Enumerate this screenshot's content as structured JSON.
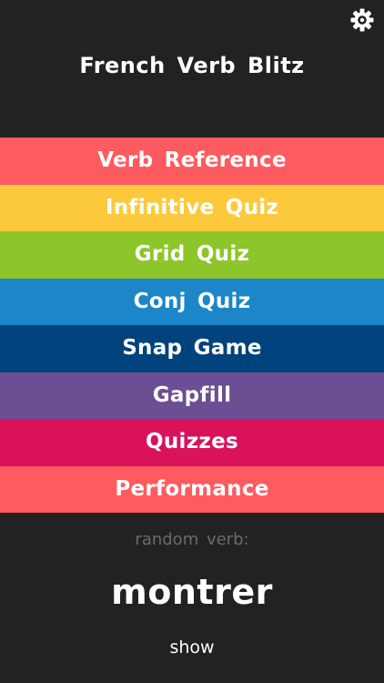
{
  "header": {
    "title": "French Verb Blitz",
    "settings_icon": "gear-icon"
  },
  "menu": {
    "items": [
      {
        "label": "Verb Reference",
        "color": "#FD5B5F"
      },
      {
        "label": "Infinitive Quiz",
        "color": "#FDC93C"
      },
      {
        "label": "Grid Quiz",
        "color": "#8DC62B"
      },
      {
        "label": "Conj Quiz",
        "color": "#1B86C8"
      },
      {
        "label": "Snap Game",
        "color": "#00427B"
      },
      {
        "label": "Gapfill",
        "color": "#6B4E94"
      },
      {
        "label": "Quizzes",
        "color": "#D9125B"
      },
      {
        "label": "Performance",
        "color": "#FD5B5F"
      }
    ]
  },
  "random": {
    "label": "random verb:",
    "verb": "montrer",
    "show_label": "show"
  },
  "colors": {
    "background": "#222222",
    "muted_text": "#6B6B6B"
  }
}
